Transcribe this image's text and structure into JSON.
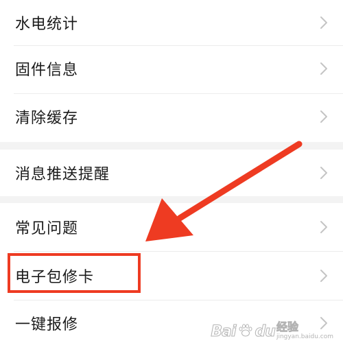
{
  "menu": {
    "group1": [
      {
        "label": "水电统计"
      },
      {
        "label": "固件信息"
      },
      {
        "label": "清除缓存"
      }
    ],
    "group2": [
      {
        "label": "消息推送提醒"
      }
    ],
    "group3": [
      {
        "label": "常见问题"
      },
      {
        "label": "电子包修卡"
      },
      {
        "label": "一键报修"
      }
    ],
    "chevron_icon": "chevron-right-icon"
  },
  "annotation": {
    "highlighted_item": "电子包修卡",
    "color": "#ee3b22"
  },
  "watermark": {
    "brand": "Bai",
    "brand_tail": "du",
    "cn": "经验",
    "url": "jingyan.baidu.com"
  },
  "colors": {
    "text": "#1a1a1a",
    "chevron": "#c4c4c4",
    "divider": "#ececec",
    "gap": "#f3f3f3",
    "accent": "#ee3b22"
  }
}
